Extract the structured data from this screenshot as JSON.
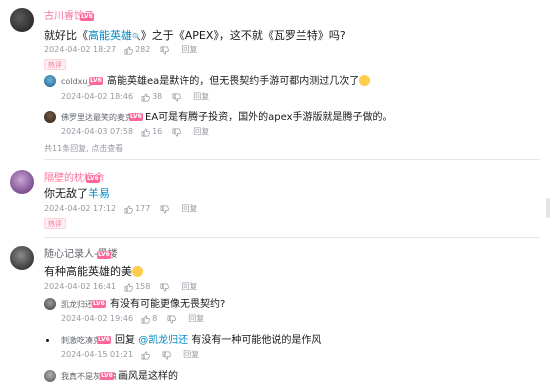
{
  "comments": [
    {
      "user": "古川睿饺子",
      "level": "LV6",
      "text_prefix": "就好比《",
      "text_link": "高能英雄",
      "text_suffix": "》之于《APEX》，这不就《瓦罗兰特》吗?",
      "time": "2024-04-02 18:27",
      "likes": "282",
      "reply_label": "回复",
      "badge": "热评",
      "replies": [
        {
          "user": "coldxu_",
          "level": "LV6",
          "text": "高能英雄ea是默许的，但无畏契约手游可都内测过几次了",
          "time": "2024-04-02 18:46",
          "likes": "38",
          "reply_label": "回复"
        },
        {
          "user": "佛罗里达最笑的麦克",
          "level": "LV6",
          "text": "EA可是有腾子投资，国外的apex手游版就是腾子做的。",
          "time": "2024-04-03 07:58",
          "likes": "16",
          "reply_label": "回复"
        }
      ],
      "more_replies": "共11条回复, 点击查看"
    },
    {
      "user": "隔壁的枕梅命",
      "level": "LV6",
      "text_prefix": "你无敌了",
      "text_link": "羊易",
      "text_suffix": "",
      "time": "2024-04-02 17:12",
      "likes": "177",
      "reply_label": "回复",
      "badge": "热评"
    },
    {
      "user": "随心记录人-黑楼",
      "level": "LV6",
      "text_prefix": "有种高能英雄的美",
      "time": "2024-04-02 16:41",
      "likes": "158",
      "reply_label": "回复",
      "replies": [
        {
          "user": "凯龙归还",
          "level": "LV6",
          "text": "有没有可能更像无畏契约?",
          "time": "2024-04-02 19:46",
          "likes": "8",
          "reply_label": "回复"
        },
        {
          "user": "刺激吃凑克",
          "level": "LV6",
          "text_prefix": "回复 ",
          "text_link": "@凯龙归还",
          "text": "有没有一种可能他说的是作风",
          "time": "2024-04-15 01:21",
          "likes": "",
          "reply_label": "回复"
        },
        {
          "user": "我真不是灰太狼",
          "level": "LV6",
          "text": "画风是这样的"
        }
      ]
    }
  ],
  "colors": {
    "link": "#008ac5",
    "meta": "#9499a0",
    "level": "#ff6699",
    "hot": "#fb7299",
    "divider": "#e3e5e7"
  }
}
